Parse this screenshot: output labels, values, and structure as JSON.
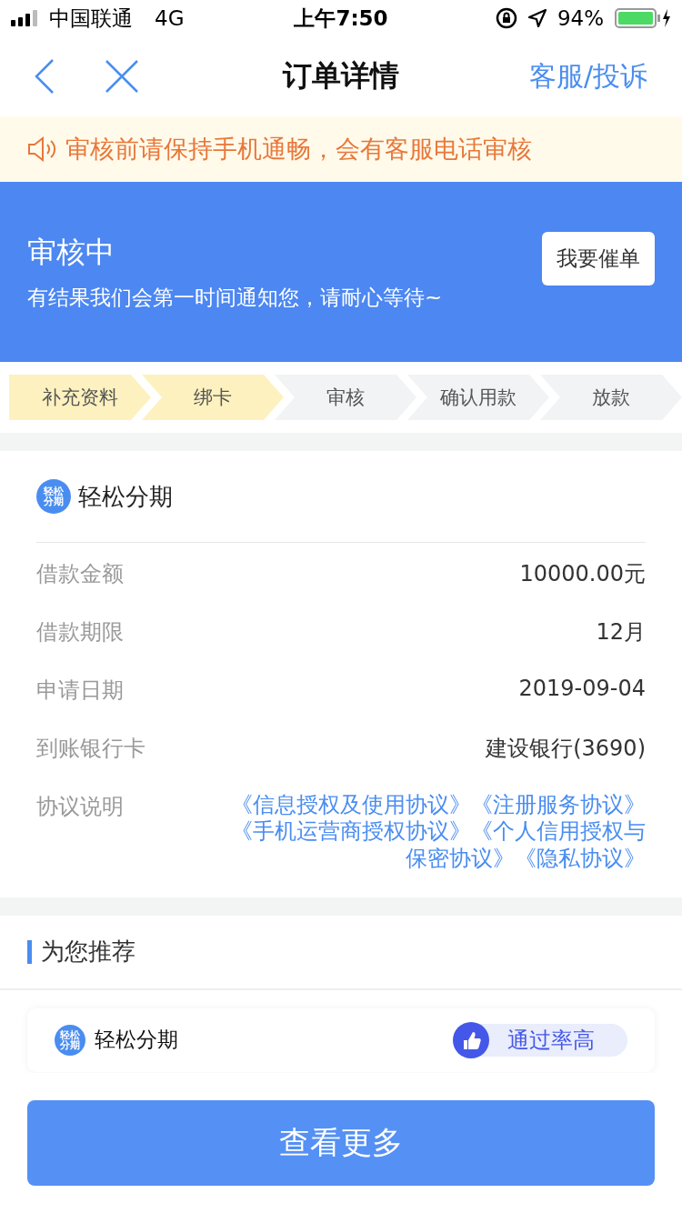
{
  "status_bar": {
    "carrier": "中国联通",
    "network": "4G",
    "time": "上午7:50",
    "battery": "94%"
  },
  "nav": {
    "title": "订单详情",
    "action": "客服/投诉"
  },
  "notice": "审核前请保持手机通畅，会有客服电话审核",
  "status": {
    "title": "审核中",
    "message": "有结果我们会第一时间通知您，请耐心等待~",
    "button": "我要催单"
  },
  "steps": [
    {
      "label": "补充资料",
      "done": true
    },
    {
      "label": "绑卡",
      "done": true
    },
    {
      "label": "审核",
      "done": false
    },
    {
      "label": "确认用款",
      "done": false
    },
    {
      "label": "放款",
      "done": false
    }
  ],
  "order": {
    "logo_lines": [
      "轻松",
      "分期"
    ],
    "product": "轻松分期",
    "rows": [
      {
        "label": "借款金额",
        "value": "10000.00元"
      },
      {
        "label": "借款期限",
        "value": "12月"
      },
      {
        "label": "申请日期",
        "value": "2019-09-04"
      },
      {
        "label": "到账银行卡",
        "value": "建设银行(3690)"
      }
    ],
    "agreement_label": "协议说明",
    "agreements": "《信息授权及使用协议》《注册服务协议》《手机运营商授权协议》《个人信用授权与保密协议》《隐私协议》"
  },
  "recommend": {
    "title": "为您推荐",
    "logo_lines": [
      "轻松",
      "分期"
    ],
    "product": "轻松分期",
    "tag": "通过率高"
  },
  "more_button": "查看更多"
}
